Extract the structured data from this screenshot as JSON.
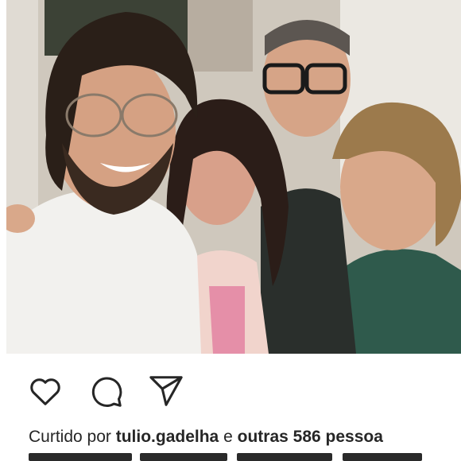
{
  "post": {
    "photo_alt": "",
    "liked_by_prefix": "Curtido por",
    "liked_by_user": "tulio.gadelha",
    "liked_by_joiner": "e",
    "liked_by_others": "outras 586 pessoa"
  },
  "actions": [
    {
      "name": "like",
      "icon": "heart-icon"
    },
    {
      "name": "comment",
      "icon": "comment-icon"
    },
    {
      "name": "share",
      "icon": "send-icon"
    }
  ],
  "colors": {
    "text": "#262626",
    "icon_stroke": "#262626",
    "background": "#ffffff"
  }
}
